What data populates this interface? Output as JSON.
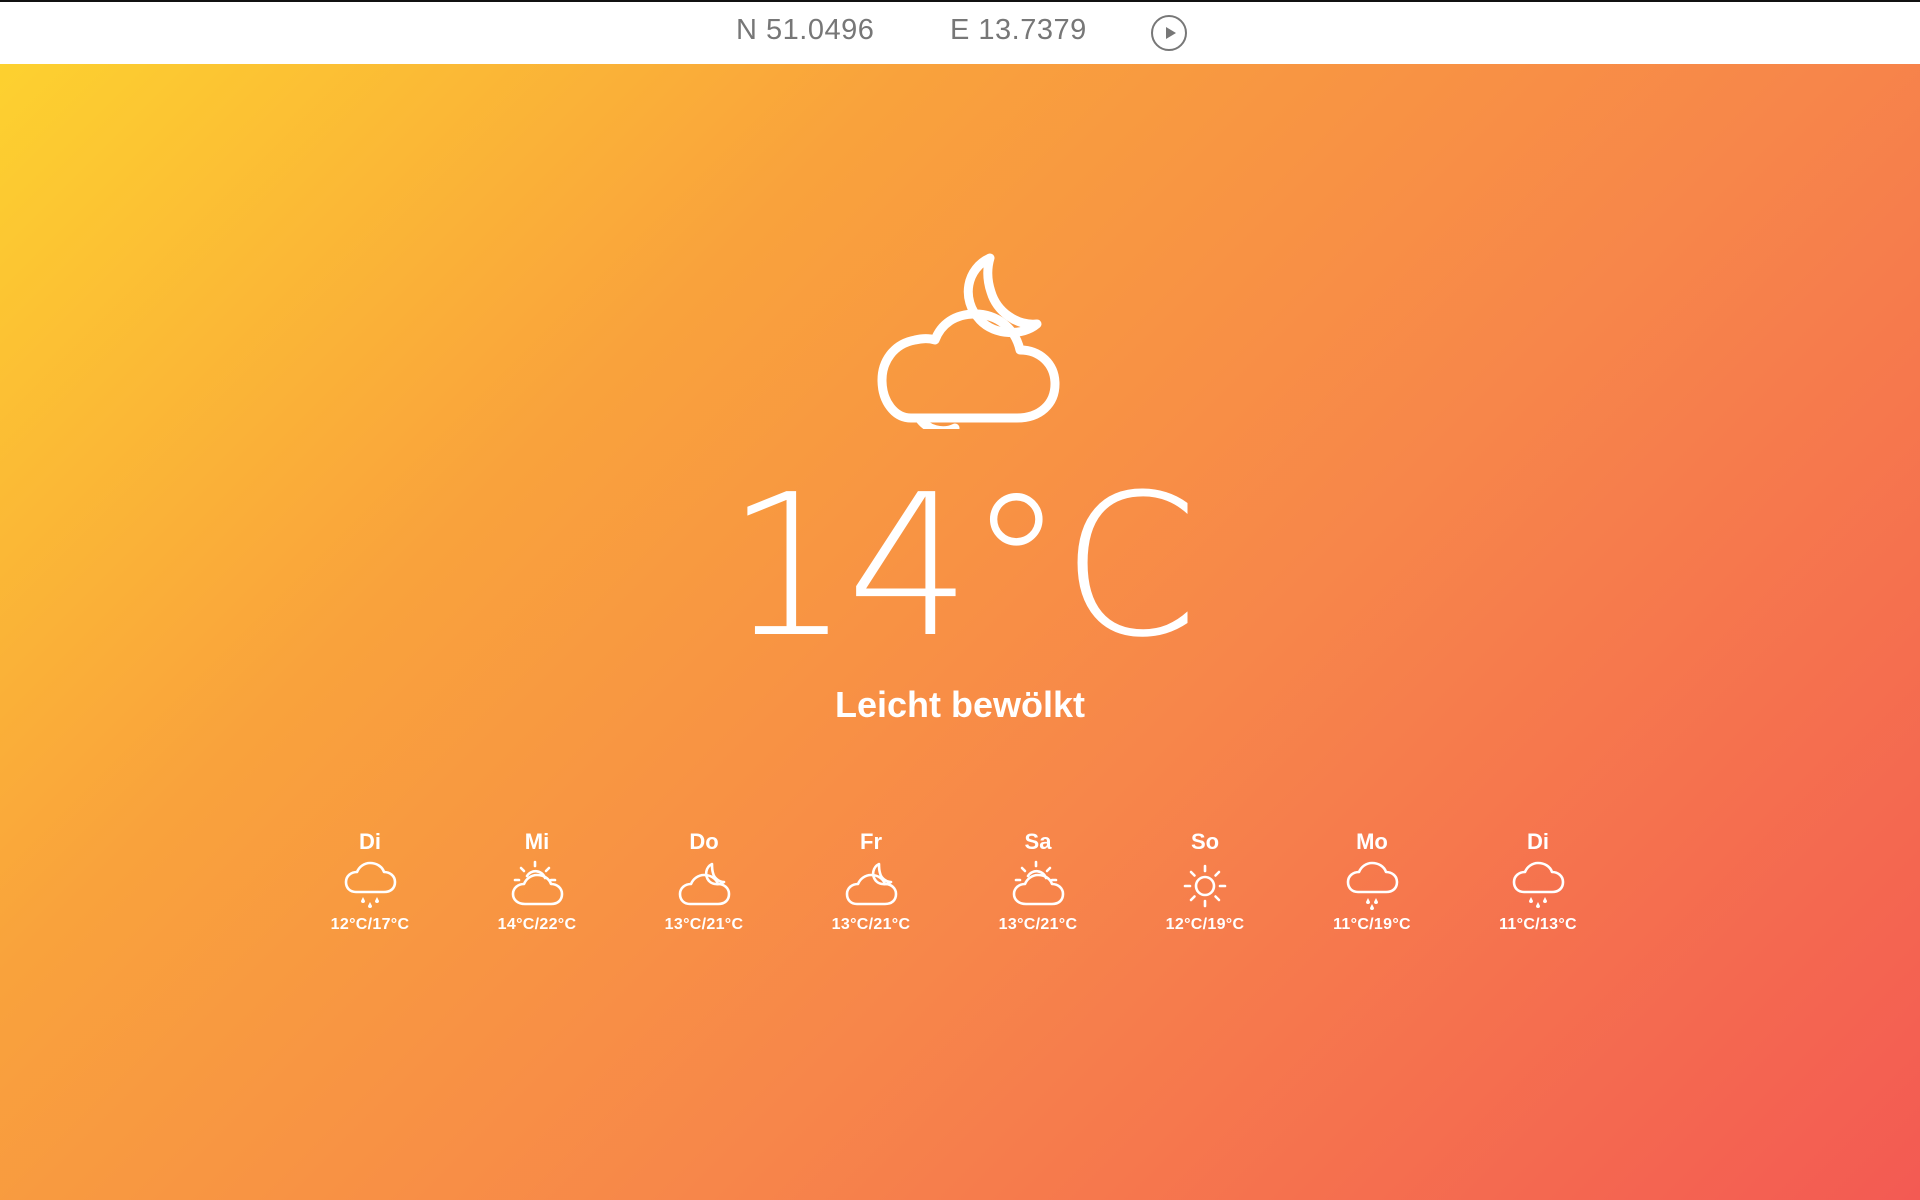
{
  "header": {
    "lat_prefix": "N",
    "lat": "51.0496",
    "lon_prefix": "E",
    "lon": "13.7379",
    "play_icon": "play-circle-icon"
  },
  "current": {
    "icon": "cloud-moon-icon",
    "temperature": "14°C",
    "description": "Leicht bewölkt"
  },
  "forecast": [
    {
      "day": "Di",
      "icon": "rain-icon",
      "temp": "12°C/17°C"
    },
    {
      "day": "Mi",
      "icon": "partly-sunny-icon",
      "temp": "14°C/22°C"
    },
    {
      "day": "Do",
      "icon": "cloud-moon-icon",
      "temp": "13°C/21°C"
    },
    {
      "day": "Fr",
      "icon": "cloud-moon-icon",
      "temp": "13°C/21°C"
    },
    {
      "day": "Sa",
      "icon": "partly-sunny-icon",
      "temp": "13°C/21°C"
    },
    {
      "day": "So",
      "icon": "sun-icon",
      "temp": "12°C/19°C"
    },
    {
      "day": "Mo",
      "icon": "rain-icon",
      "temp": "11°C/19°C"
    },
    {
      "day": "Di",
      "icon": "rain-icon",
      "temp": "11°C/13°C"
    }
  ],
  "colors": {
    "gradient_start": "#fdd12f",
    "gradient_mid": "#f9a23c",
    "gradient_end": "#f35a53",
    "text": "#ffffff"
  }
}
